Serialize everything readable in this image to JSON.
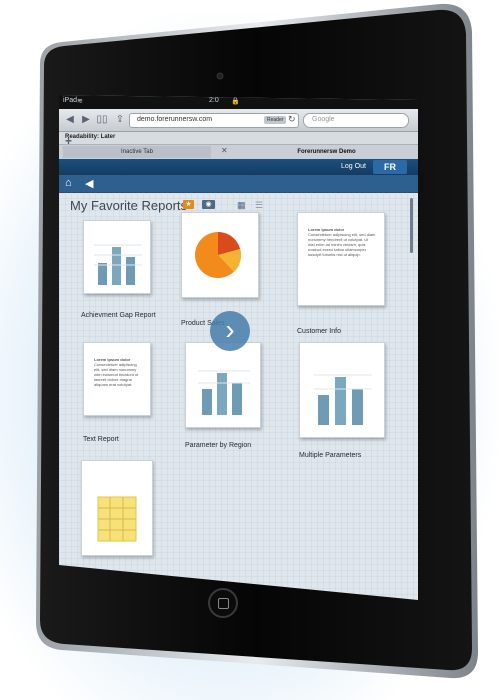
{
  "statusbar": {
    "carrier": "iPad",
    "clock": "2:0",
    "lock": "🔒"
  },
  "browser": {
    "url": "demo.forerunnersw.com",
    "reader_label": "Reader",
    "search_placeholder": "Google",
    "readability": "Readability: Later",
    "tabs": [
      {
        "label": "Inactive Tab"
      },
      {
        "label": "Forerunnersw Demo"
      }
    ]
  },
  "app": {
    "logout": "Log Out",
    "logo": "FR",
    "page_title": "My Favorite Reports",
    "reports": [
      {
        "label": "Achievment Gap Report",
        "icon": "bar-chart-icon"
      },
      {
        "label": "Product Sales",
        "icon": "pie-chart-icon"
      },
      {
        "label": "Customer Info",
        "icon": "text-document-icon",
        "text_title": "Lorem ipsum dolor",
        "text_body": "Consectetuer adipiscing elit, sed diam nonummy hendrerit ut volutpat. Ut wisi enim ad minim veniam, quis nostrud exerci tation ullamcorper suscipit lobortis nisl ut aliquip."
      },
      {
        "label": "Text Report",
        "icon": "text-document-icon",
        "text_title": "Lorem ipsum dolor",
        "text_body": "Consectetuer adipiscing elit, sed diam nonummy nibh euismod tincidunt ut laoreet dolore magna aliquam erat volutpat."
      },
      {
        "label": "Parameter by Region",
        "icon": "bar-chart-icon"
      },
      {
        "label": "Multiple Parameters",
        "icon": "bar-chart-icon"
      },
      {
        "label": "",
        "icon": "spreadsheet-icon"
      }
    ]
  },
  "colors": {
    "header_blue": "#1c4f80",
    "accent_orange": "#e58b15",
    "chart_bar": "#6f9bb4"
  }
}
